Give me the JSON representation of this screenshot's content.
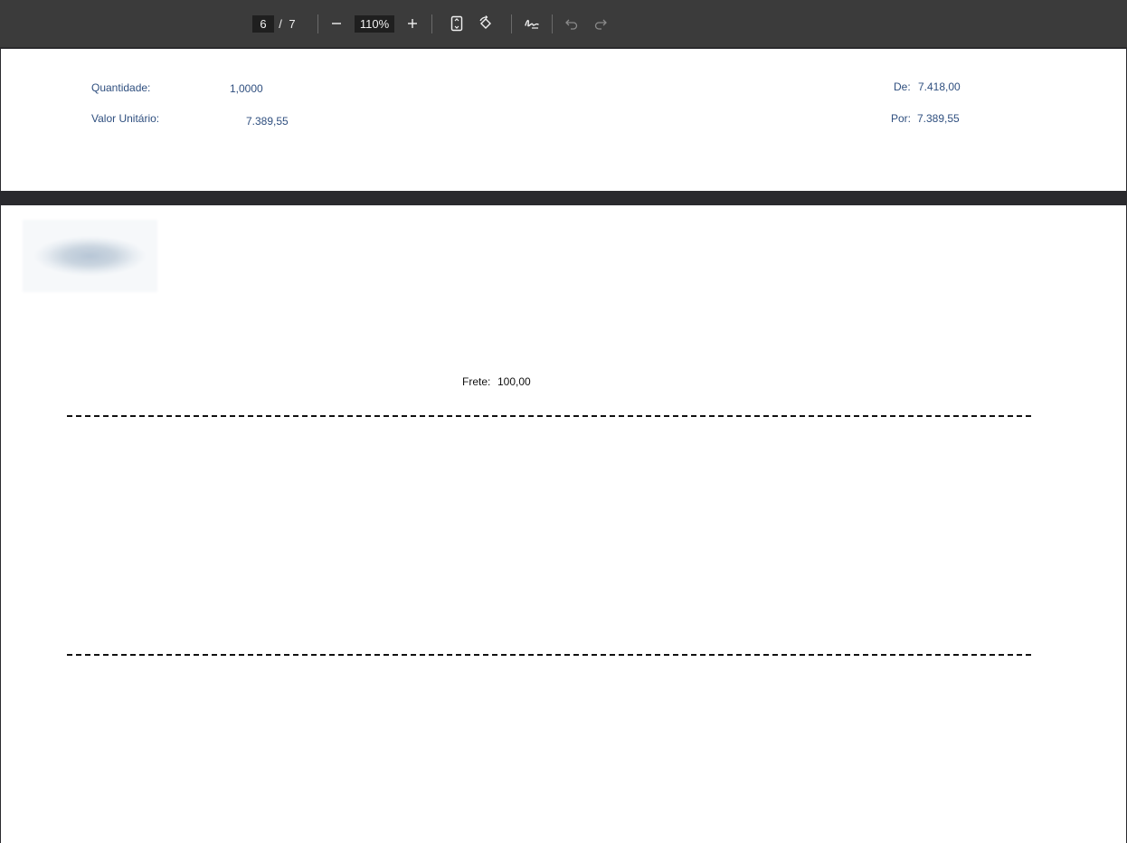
{
  "toolbar": {
    "page_current": "6",
    "page_separator": "/",
    "page_total": "7",
    "zoom_value": "110%",
    "zoom_out_label": "−",
    "zoom_in_label": "+"
  },
  "page_top": {
    "quantidade_label": "Quantidade:",
    "quantidade_value": "1,0000",
    "valor_unitario_label": "Valor Unitário:",
    "valor_unitario_value": "7.389,55",
    "de_label": "De:",
    "de_value": "7.418,00",
    "por_label": "Por:",
    "por_value": "7.389,55"
  },
  "page_bottom": {
    "frete_label": "Frete:",
    "frete_value": "100,00"
  },
  "colors": {
    "toolbar_bg": "#3b3b3b",
    "viewer_bg": "#2a2a2e",
    "label_blue": "#2f4f7f"
  }
}
